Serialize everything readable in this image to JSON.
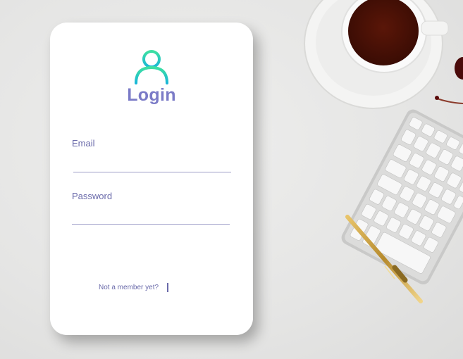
{
  "login": {
    "title": "Login",
    "email_label": "Email",
    "email_value": "",
    "password_label": "Password",
    "password_value": "",
    "signup_prompt": "Not a member yet?"
  },
  "icons": {
    "user": "user-icon"
  },
  "colors": {
    "accent": "#7b7bc7",
    "label": "#6a6aaa",
    "icon_gradient_top": "#3ee0a2",
    "icon_gradient_bottom": "#19b6d8",
    "card": "#ffffff",
    "background": "#e6e6e5"
  }
}
